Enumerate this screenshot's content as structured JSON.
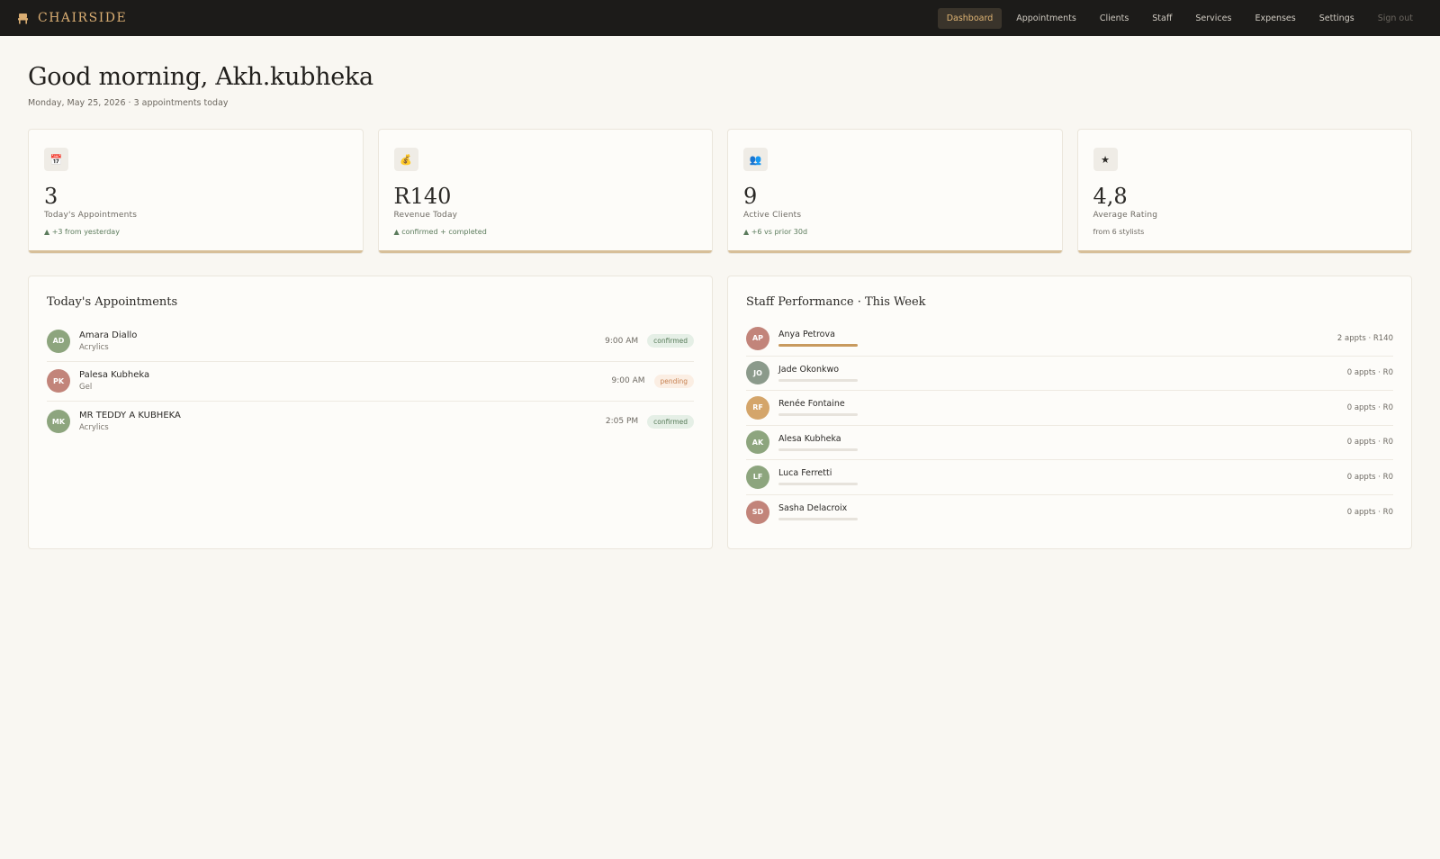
{
  "brand": {
    "name": "CHAIRSIDE",
    "icon": "chair-icon"
  },
  "nav": {
    "items": [
      {
        "label": "Dashboard",
        "active": true
      },
      {
        "label": "Appointments"
      },
      {
        "label": "Clients"
      },
      {
        "label": "Staff"
      },
      {
        "label": "Services"
      },
      {
        "label": "Expenses"
      },
      {
        "label": "Settings"
      }
    ],
    "signout": "Sign out"
  },
  "header": {
    "greeting": "Good morning, Akh.kubheka",
    "subline": "Monday, May 25, 2026 · 3 appointments today"
  },
  "stats": [
    {
      "icon": "📅",
      "icon_name": "calendar-icon",
      "value": "3",
      "label": "Today's Appointments",
      "note": "▲ +3 from yesterday"
    },
    {
      "icon": "💰",
      "icon_name": "money-bag-icon",
      "value": "R140",
      "label": "Revenue Today",
      "note": "▲ confirmed + completed"
    },
    {
      "icon": "👥",
      "icon_name": "users-icon",
      "value": "9",
      "label": "Active Clients",
      "note": "▲ +6 vs prior 30d"
    },
    {
      "icon": "★",
      "icon_name": "star-icon",
      "value": "4,8",
      "label": "Average Rating",
      "note": "from 6 stylists"
    }
  ],
  "appointments": {
    "title": "Today's Appointments",
    "rows": [
      {
        "initials": "AD",
        "name": "Amara Diallo",
        "service": "Acrylics",
        "time": "9:00 AM",
        "status": "confirmed",
        "color": "#8da57e"
      },
      {
        "initials": "PK",
        "name": "Palesa Kubheka",
        "service": "Gel",
        "time": "9:00 AM",
        "status": "pending",
        "color": "#c2847a"
      },
      {
        "initials": "MK",
        "name": "MR TEDDY A KUBHEKA",
        "service": "Acrylics",
        "time": "2:05 PM",
        "status": "confirmed",
        "color": "#8da57e"
      }
    ]
  },
  "staff": {
    "title": "Staff Performance · This Week",
    "rows": [
      {
        "initials": "AP",
        "name": "Anya Petrova",
        "stat": "2 appts · R140",
        "fill": 1.0,
        "color": "#c2847a"
      },
      {
        "initials": "JO",
        "name": "Jade Okonkwo",
        "stat": "0 appts · R0",
        "fill": 0,
        "color": "#8b9a8b"
      },
      {
        "initials": "RF",
        "name": "Renée Fontaine",
        "stat": "0 appts · R0",
        "fill": 0,
        "color": "#d4a56a"
      },
      {
        "initials": "AK",
        "name": "Alesa Kubheka",
        "stat": "0 appts · R0",
        "fill": 0,
        "color": "#8da57e"
      },
      {
        "initials": "LF",
        "name": "Luca Ferretti",
        "stat": "0 appts · R0",
        "fill": 0,
        "color": "#8da57e"
      },
      {
        "initials": "SD",
        "name": "Sasha Delacroix",
        "stat": "0 appts · R0",
        "fill": 0,
        "color": "#c2847a"
      }
    ]
  }
}
